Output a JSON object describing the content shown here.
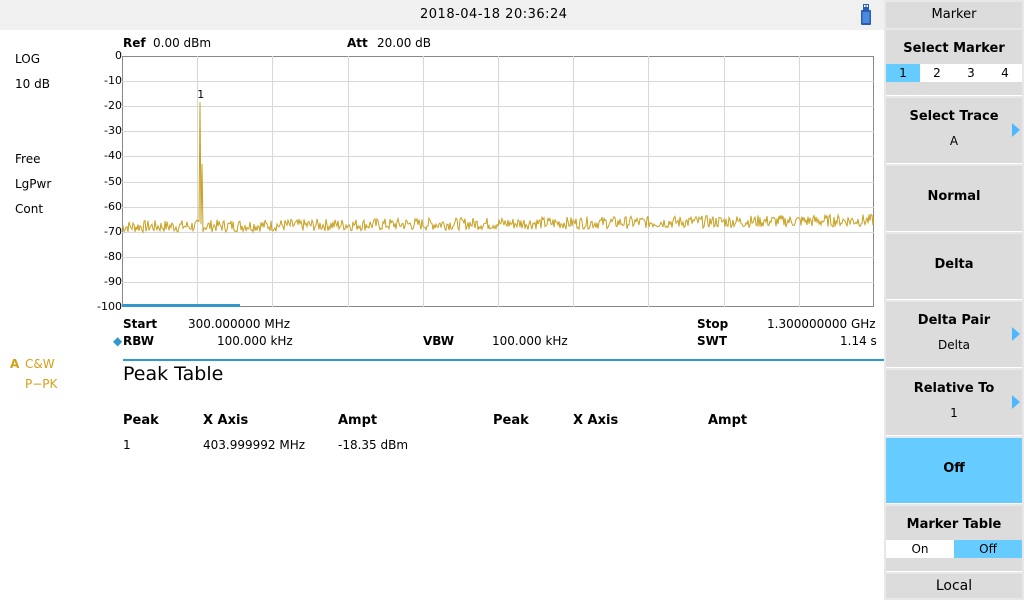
{
  "header": {
    "datetime": "2018-04-18   20:36:24"
  },
  "left": {
    "scale_mode": "LOG",
    "scale_div": "10 dB",
    "trig": "Free",
    "avg": "LgPwr",
    "sweep": "Cont",
    "trace_id": "A",
    "trace_mode": "C&W",
    "detector": "P−PK"
  },
  "plot_header": {
    "ref_label": "Ref",
    "ref_value": "0.00 dBm",
    "att_label": "Att",
    "att_value": "20.00 dB"
  },
  "chart_data": {
    "type": "line",
    "ylim": [
      -100,
      0
    ],
    "yticks": [
      "0",
      "-10",
      "-20",
      "-30",
      "-40",
      "-50",
      "-60",
      "-70",
      "-80",
      "-90",
      "-100"
    ],
    "x_start_mhz": 300.0,
    "x_stop_mhz": 1300.0,
    "grid": true,
    "trace_color": "#c8a020",
    "noise_floor_dbm": -68,
    "peak": {
      "x_mhz": 404.0,
      "y_dbm": -18.35,
      "label": "1"
    }
  },
  "sweep": {
    "start_label": "Start",
    "start_value": "300.000000 MHz",
    "stop_label": "Stop",
    "stop_value": "1.300000000 GHz",
    "rbw_label": "RBW",
    "rbw_value": "100.000 kHz",
    "vbw_label": "VBW",
    "vbw_value": "100.000 kHz",
    "swt_label": "SWT",
    "swt_value": "1.14 s"
  },
  "peak_table": {
    "title": "Peak Table",
    "headers": [
      "Peak",
      "X Axis",
      "Ampt",
      "Peak",
      "X Axis",
      "Ampt"
    ],
    "rows": [
      {
        "peak": "1",
        "x": "403.999992 MHz",
        "ampt": "-18.35 dBm"
      }
    ]
  },
  "menu": {
    "title": "Marker",
    "select_marker": {
      "label": "Select Marker",
      "options": [
        "1",
        "2",
        "3",
        "4"
      ],
      "selected": "1"
    },
    "select_trace": {
      "label": "Select Trace",
      "value": "A"
    },
    "normal": "Normal",
    "delta": "Delta",
    "delta_pair": {
      "label": "Delta Pair",
      "value": "Delta"
    },
    "relative_to": {
      "label": "Relative To",
      "value": "1"
    },
    "off": "Off",
    "marker_table": {
      "label": "Marker Table",
      "on": "On",
      "off": "Off",
      "selected": "Off"
    },
    "local": "Local"
  },
  "colors": {
    "accent": "#66ccff",
    "trace": "#c8a020",
    "trace_label": "#d4a017",
    "divider": "#3399cc"
  }
}
